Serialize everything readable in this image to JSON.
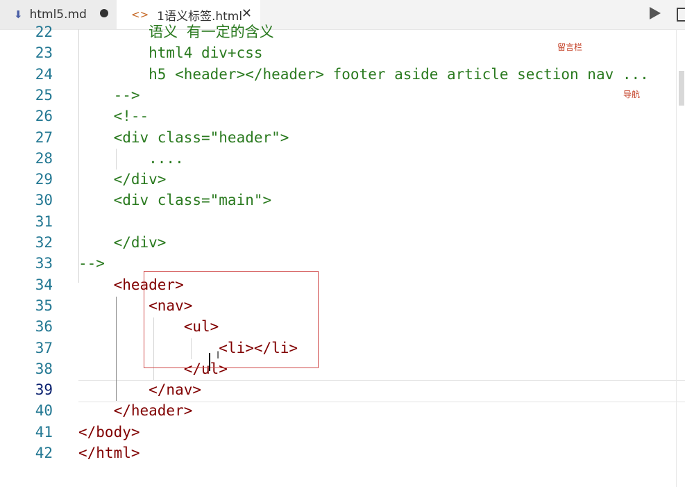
{
  "tabs": [
    {
      "label": "html5.md",
      "icon": "markdown-download-icon",
      "modified": true
    },
    {
      "label": "1语义标签.html",
      "icon": "code-brackets-icon",
      "active": true
    }
  ],
  "toolbar": {
    "run": "run-icon",
    "split": "split-editor-icon"
  },
  "annotations": {
    "liuyan": "留言栏",
    "daohang": "导航"
  },
  "editor": {
    "current_line": 39,
    "lines": [
      {
        "n": "22",
        "segs": [
          {
            "c": "cm",
            "t": "        语义 有一定的含义"
          }
        ]
      },
      {
        "n": "23",
        "segs": [
          {
            "c": "cm",
            "t": "        html4 div+css"
          }
        ]
      },
      {
        "n": "24",
        "segs": [
          {
            "c": "cm",
            "t": "        h5 <header></header> footer aside article section nav ..."
          }
        ]
      },
      {
        "n": "25",
        "segs": [
          {
            "c": "cm",
            "t": "    -->"
          }
        ]
      },
      {
        "n": "26",
        "segs": [
          {
            "c": "cm",
            "t": "    <!--"
          }
        ]
      },
      {
        "n": "27",
        "segs": [
          {
            "c": "cm",
            "t": "    <div class=\"header\">"
          }
        ]
      },
      {
        "n": "28",
        "segs": [
          {
            "c": "cm",
            "t": "        ...."
          }
        ]
      },
      {
        "n": "29",
        "segs": [
          {
            "c": "cm",
            "t": "    </div>"
          }
        ]
      },
      {
        "n": "30",
        "segs": [
          {
            "c": "cm",
            "t": "    <div class=\"main\">"
          }
        ]
      },
      {
        "n": "31",
        "segs": [
          {
            "c": "cm",
            "t": ""
          }
        ]
      },
      {
        "n": "32",
        "segs": [
          {
            "c": "cm",
            "t": "    </div>"
          }
        ]
      },
      {
        "n": "33",
        "segs": [
          {
            "c": "cm",
            "t": "-->"
          }
        ]
      },
      {
        "n": "34",
        "segs": [
          {
            "c": "tg",
            "t": "    <header>"
          }
        ]
      },
      {
        "n": "35",
        "segs": [
          {
            "c": "tg",
            "t": "        <nav>"
          }
        ]
      },
      {
        "n": "36",
        "segs": [
          {
            "c": "tg",
            "t": "            <ul>"
          }
        ]
      },
      {
        "n": "37",
        "segs": [
          {
            "c": "tg",
            "t": "                <li></li>"
          }
        ]
      },
      {
        "n": "38",
        "segs": [
          {
            "c": "tg",
            "t": "            </ul>"
          }
        ]
      },
      {
        "n": "39",
        "segs": [
          {
            "c": "tg",
            "t": "        </nav>"
          }
        ]
      },
      {
        "n": "40",
        "segs": [
          {
            "c": "tg",
            "t": "    </header>"
          }
        ]
      },
      {
        "n": "41",
        "segs": [
          {
            "c": "tg",
            "t": "</body>"
          }
        ]
      },
      {
        "n": "42",
        "segs": [
          {
            "c": "tg",
            "t": "</html>"
          }
        ]
      }
    ]
  }
}
